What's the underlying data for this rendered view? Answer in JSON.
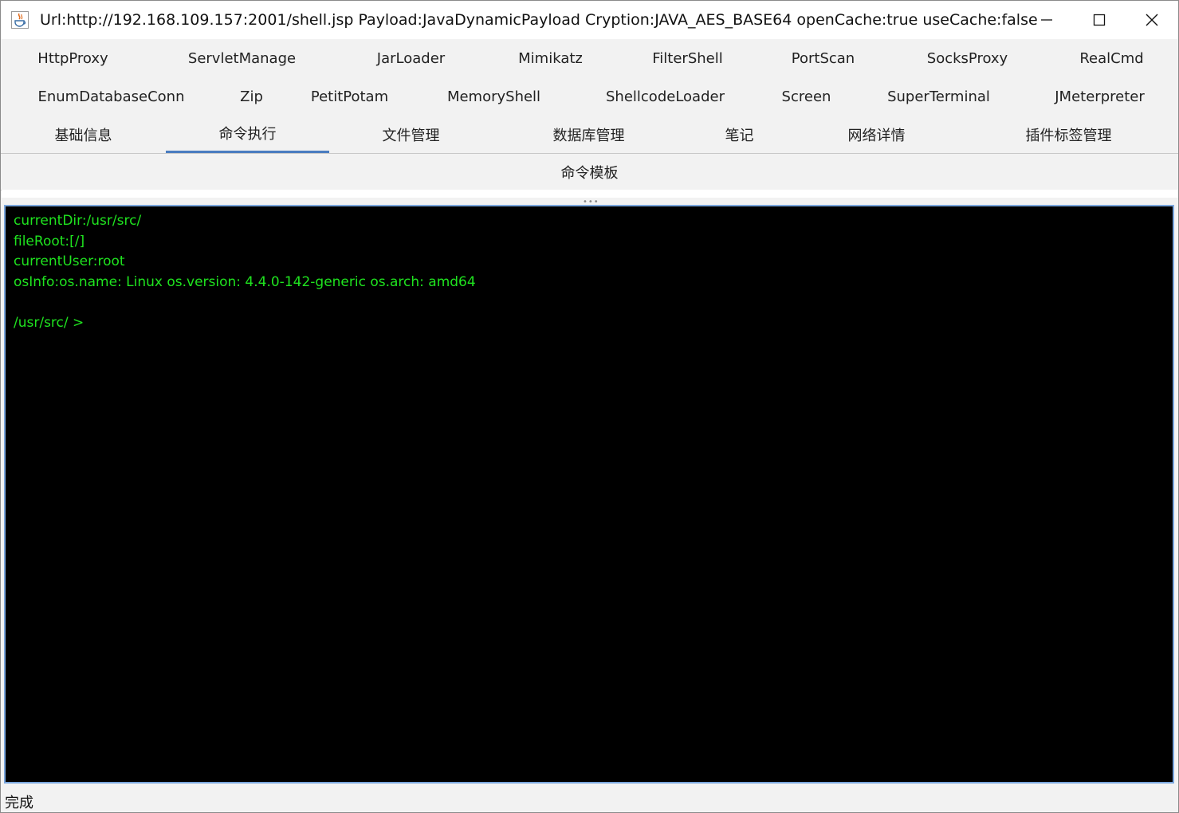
{
  "window": {
    "title": "Url:http://192.168.109.157:2001/shell.jsp Payload:JavaDynamicPayload Cryption:JAVA_AES_BASE64 openCache:true useCache:false",
    "icon": "java-icon",
    "controls": [
      "minimize-icon",
      "maximize-icon",
      "close-icon"
    ]
  },
  "tabs": {
    "row1": [
      "HttpProxy",
      "ServletManage",
      "JarLoader",
      "Mimikatz",
      "FilterShell",
      "PortScan",
      "SocksProxy",
      "RealCmd"
    ],
    "row2": [
      "EnumDatabaseConn",
      "Zip",
      "PetitPotam",
      "MemoryShell",
      "ShellcodeLoader",
      "Screen",
      "SuperTerminal",
      "JMeterpreter"
    ],
    "row3": [
      "基础信息",
      "命令执行",
      "文件管理",
      "数据库管理",
      "笔记",
      "网络详情",
      "插件标签管理"
    ],
    "active": "命令执行"
  },
  "command_template": {
    "label": "命令模板"
  },
  "console": {
    "lines": [
      "currentDir:/usr/src/",
      "fileRoot:[/]",
      "currentUser:root",
      "osInfo:os.name: Linux os.version: 4.4.0-142-generic os.arch: amd64",
      "",
      "/usr/src/ >"
    ],
    "text_color": "#1fe31f",
    "background": "#000000"
  },
  "status": {
    "text": "完成"
  },
  "colors": {
    "accent": "#4a7cc0"
  }
}
